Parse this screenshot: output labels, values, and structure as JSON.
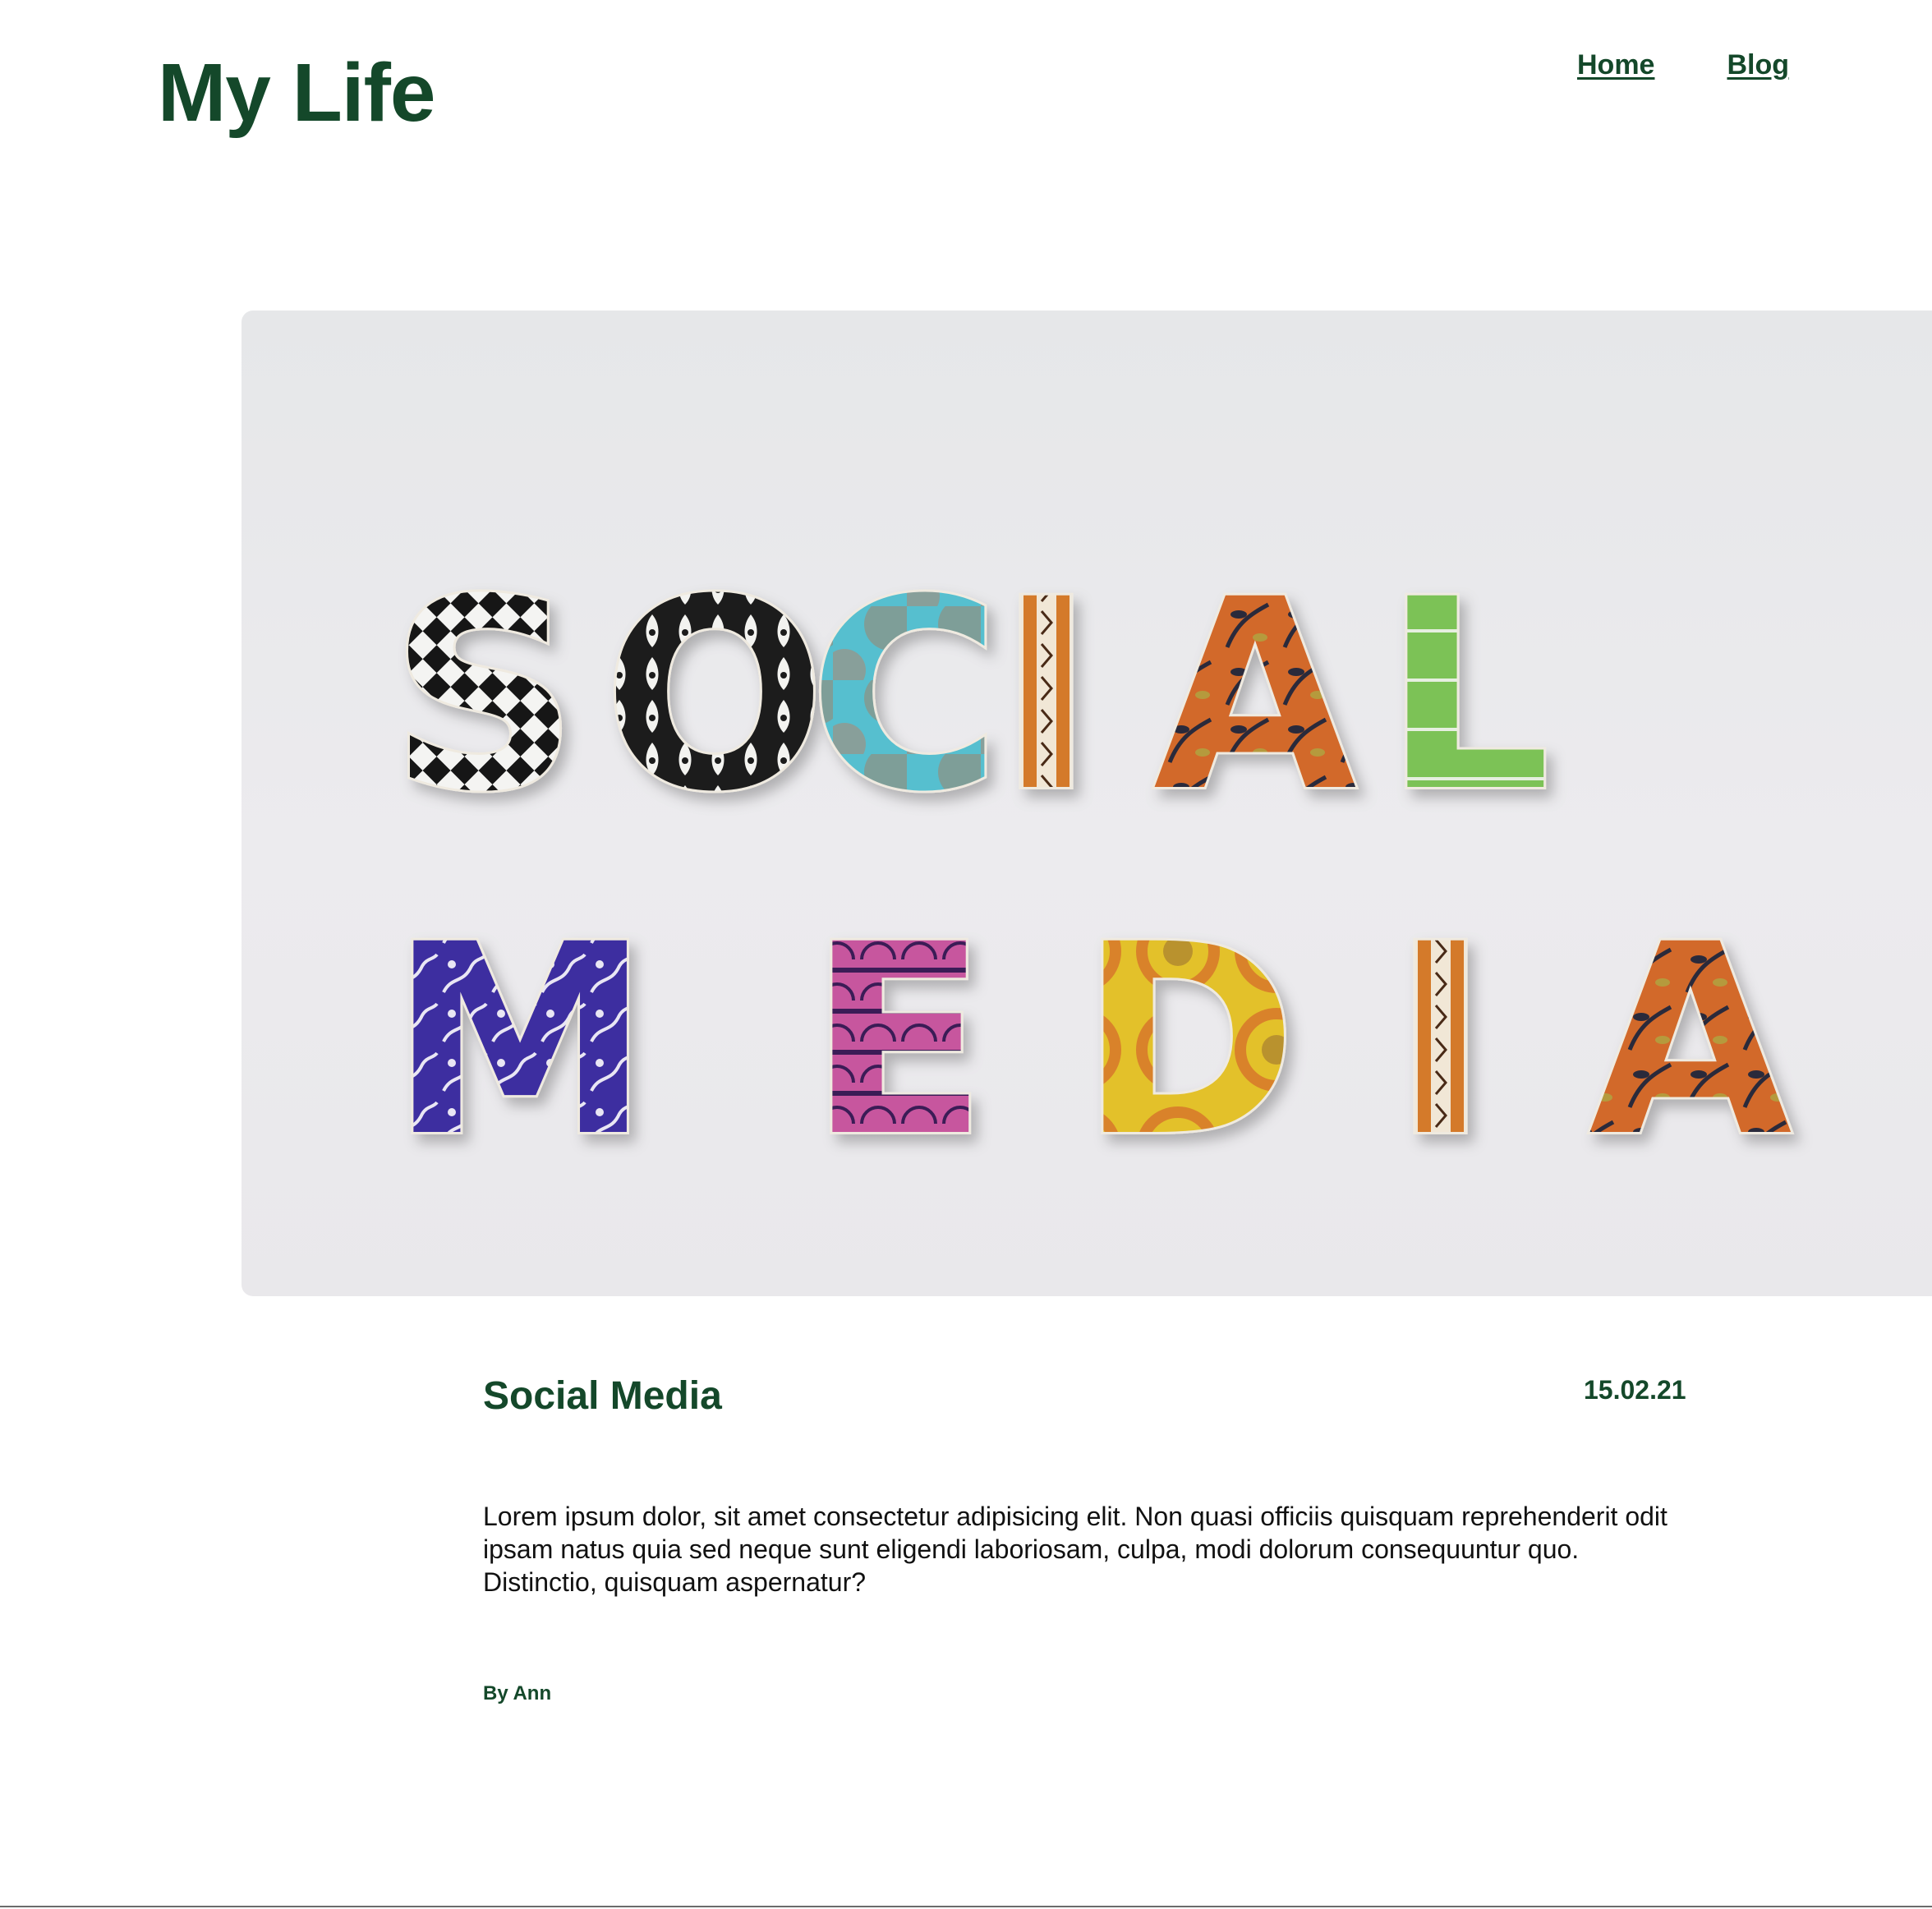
{
  "header": {
    "site_title": "My Life",
    "nav": [
      {
        "label": "Home"
      },
      {
        "label": "Blog"
      }
    ]
  },
  "hero": {
    "alt": "Patterned letter magnets spelling SOCIAL MEDIA",
    "letters_row1": [
      "S",
      "O",
      "C",
      "I",
      "A",
      "L"
    ],
    "letters_row2": [
      "M",
      "E",
      "D",
      "I",
      "A"
    ]
  },
  "post": {
    "title": "Social Media",
    "date": "15.02.21",
    "body": "Lorem ipsum dolor, sit amet consectetur adipisicing elit. Non quasi officiis quisquam reprehenderit odit ipsam natus quia sed neque sunt eligendi laboriosam, culpa, modi dolorum consequuntur quo. Distinctio, quisquam aspernatur?",
    "author": "By Ann"
  },
  "colors": {
    "brand_green": "#14482a",
    "text": "#111111",
    "background": "#ffffff"
  }
}
